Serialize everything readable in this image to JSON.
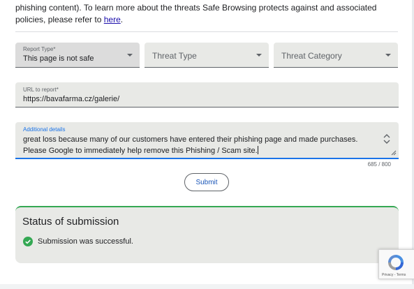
{
  "intro": {
    "text_before": "phishing content). To learn more about the threats Safe Browsing protects against and associated policies, please refer to ",
    "link_text": "here",
    "text_after": "."
  },
  "form": {
    "report_type": {
      "label": "Report Type*",
      "value": "This page is not safe"
    },
    "threat_type": {
      "placeholder": "Threat Type"
    },
    "threat_category": {
      "placeholder": "Threat Category"
    },
    "url": {
      "label": "URL to report*",
      "value": "https://bavafarma.cz/galerie/"
    },
    "details": {
      "label": "Additional details",
      "value": "great loss because many of our customers have entered their phishing page and made purchases. Please Google to immediately help remove this Phishing / Scam site.",
      "counter": "685 / 800"
    },
    "submit_label": "Submit"
  },
  "status": {
    "title": "Status of submission",
    "message": "Submission was successful.",
    "success_color": "#34a853"
  },
  "recaptcha": {
    "terms": "Privacy - Terms"
  }
}
